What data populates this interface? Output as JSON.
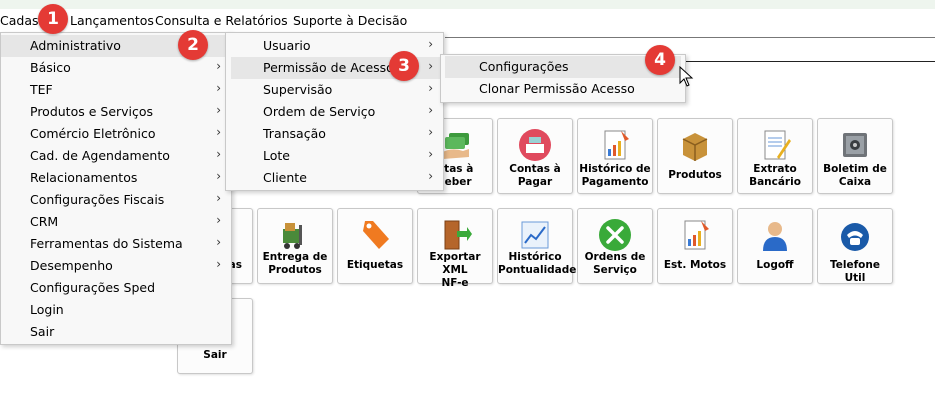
{
  "menubar": [
    {
      "label": "Cadas"
    },
    {
      "label": "Lançamentos"
    },
    {
      "label": "Consulta e Relatórios"
    },
    {
      "label": "Suporte à Decisão"
    }
  ],
  "menu1": [
    {
      "label": "Administrativo"
    },
    {
      "label": "Básico"
    },
    {
      "label": "TEF"
    },
    {
      "label": "Produtos e Serviços"
    },
    {
      "label": "Comércio Eletrônico"
    },
    {
      "label": "Cad. de Agendamento"
    },
    {
      "label": "Relacionamentos"
    },
    {
      "label": "Configurações Fiscais"
    },
    {
      "label": "CRM"
    },
    {
      "label": "Ferramentas do Sistema"
    },
    {
      "label": "Desempenho"
    },
    {
      "label": "Configurações Sped"
    },
    {
      "label": "Login"
    },
    {
      "label": "Sair"
    }
  ],
  "menu2": [
    {
      "label": "Usuario"
    },
    {
      "label": "Permissão de Acesso"
    },
    {
      "label": "Supervisão"
    },
    {
      "label": "Ordem de Serviço"
    },
    {
      "label": "Transação"
    },
    {
      "label": "Lote"
    },
    {
      "label": "Cliente"
    }
  ],
  "menu3": [
    {
      "label": "Configurações"
    },
    {
      "label": "Clonar Permissão Acesso"
    }
  ],
  "arrow_glyph": "›",
  "badges": [
    "1",
    "2",
    "3",
    "4"
  ],
  "tiles_row1": [
    {
      "label": "ntas à\nceber",
      "icon": "money-hand-icon"
    },
    {
      "label": "Contas à\nPagar",
      "icon": "cash-register-icon"
    },
    {
      "label": "Histórico de\nPagamento",
      "icon": "document-chart-icon"
    },
    {
      "label": "Produtos",
      "icon": "box-icon"
    },
    {
      "label": "Extrato\nBancário",
      "icon": "document-pen-icon"
    },
    {
      "label": "Boletim de\nCaixa",
      "icon": "safe-icon"
    }
  ],
  "tiles_row2": [
    {
      "label": "as",
      "icon": "partial-icon"
    },
    {
      "label": "Entrega de\nProdutos",
      "icon": "forklift-icon"
    },
    {
      "label": "Etiquetas",
      "icon": "tag-icon"
    },
    {
      "label": "Exportar XML\nNF-e",
      "icon": "door-arrow-icon"
    },
    {
      "label": "Histórico\nPontualidade",
      "icon": "line-chart-icon"
    },
    {
      "label": "Ordens de\nServiço",
      "icon": "tools-icon"
    },
    {
      "label": "Est. Motos",
      "icon": "document-chart-icon"
    },
    {
      "label": "Logoff",
      "icon": "user-icon"
    },
    {
      "label": "Telefone Util",
      "icon": "phone-icon"
    }
  ],
  "tile_sair": {
    "label": "Sair"
  }
}
